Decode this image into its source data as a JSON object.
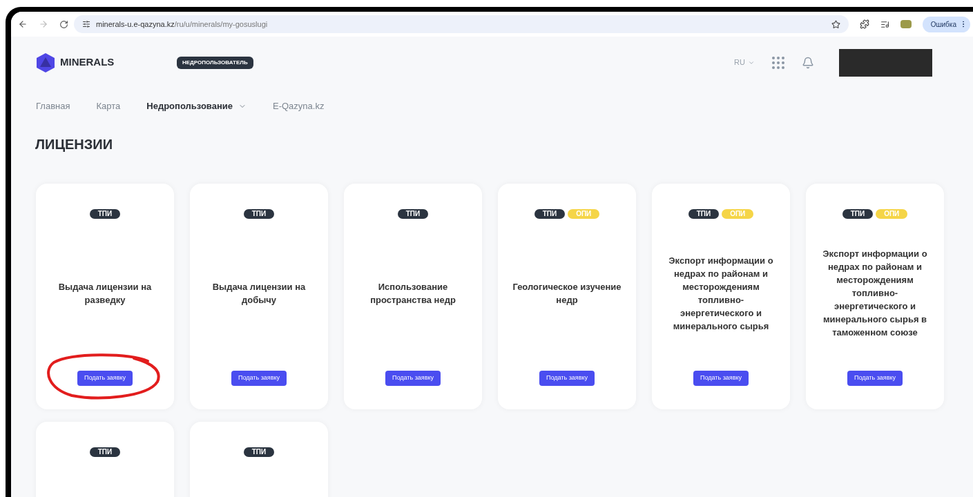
{
  "browser": {
    "url_host": "minerals-u.e-qazyna.kz",
    "url_path": "/ru/u/minerals/my-gosuslugi",
    "profile": "Ошибка"
  },
  "header": {
    "logo": "MINERALS",
    "role_badge": "НЕДРОПОЛЬЗОВАТЕЛЬ",
    "language": "RU"
  },
  "nav": [
    {
      "label": "Главная",
      "selected": false,
      "dropdown": false
    },
    {
      "label": "Карта",
      "selected": false,
      "dropdown": false
    },
    {
      "label": "Недропользование",
      "selected": true,
      "dropdown": true
    },
    {
      "label": "E-Qazyna.kz",
      "selected": false,
      "dropdown": false
    }
  ],
  "page_title": "ЛИЦЕНЗИИ",
  "cards": [
    {
      "tags": [
        {
          "label": "ТПИ",
          "color": "#2b3440"
        }
      ],
      "title": "Выдача лицензии на разведку",
      "button": "Подать заявку",
      "circled": true
    },
    {
      "tags": [
        {
          "label": "ТПИ",
          "color": "#2b3440"
        }
      ],
      "title": "Выдача лицензии на добычу",
      "button": "Подать заявку",
      "circled": false
    },
    {
      "tags": [
        {
          "label": "ТПИ",
          "color": "#2b3440"
        }
      ],
      "title": "Использование пространства недр",
      "button": "Подать заявку",
      "circled": false
    },
    {
      "tags": [
        {
          "label": "ТПИ",
          "color": "#2b3440"
        },
        {
          "label": "ОПИ",
          "color": "#f5d547"
        }
      ],
      "title": "Геологическое изучение недр",
      "button": "Подать заявку",
      "circled": false
    },
    {
      "tags": [
        {
          "label": "ТПИ",
          "color": "#2b3440"
        },
        {
          "label": "ОПИ",
          "color": "#f5d547"
        }
      ],
      "title": "Экспорт информации о недрах по районам и месторождениям топливно-энергетического и минерального сырья",
      "button": "Подать заявку",
      "circled": false
    },
    {
      "tags": [
        {
          "label": "ТПИ",
          "color": "#2b3440"
        },
        {
          "label": "ОПИ",
          "color": "#f5d547"
        }
      ],
      "title": "Экспорт информации о недрах по районам и месторождениям топливно-энергетического и минерального сырья в таможенном союзе",
      "button": "Подать заявку",
      "circled": false
    },
    {
      "tags": [
        {
          "label": "ТПИ",
          "color": "#2b3440"
        }
      ]
    },
    {
      "tags": [
        {
          "label": "ТПИ",
          "color": "#2b3440"
        }
      ]
    }
  ]
}
